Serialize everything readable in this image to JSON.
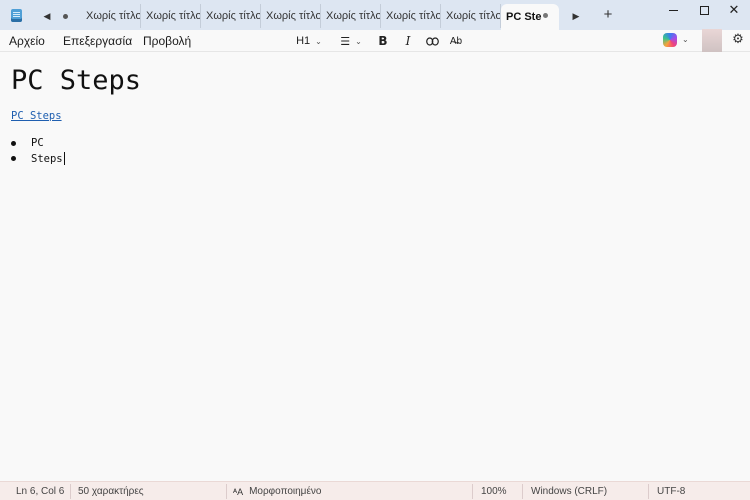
{
  "window": {
    "tabs": [
      {
        "label": "Χωρίς τίτλο"
      },
      {
        "label": "Χωρίς τίτλο"
      },
      {
        "label": "Χωρίς τίτλο"
      },
      {
        "label": "Χωρίς τίτλο"
      },
      {
        "label": "Χωρίς τίτλο"
      },
      {
        "label": "Χωρίς τίτλο"
      },
      {
        "label": "Χωρίς τίτλο"
      }
    ],
    "active_tab": {
      "label": "PC Ste"
    },
    "new_tab_glyph": "+",
    "close_glyph": "✕"
  },
  "menu": {
    "file": "Αρχείο",
    "edit": "Επεξεργασία",
    "view": "Προβολή"
  },
  "toolbar": {
    "heading": "H1",
    "list_glyph": "☰",
    "bold": "B",
    "italic": "I",
    "link_glyph": "🔗",
    "clear_format": "A̶b",
    "chevron": "⌄"
  },
  "icons": {
    "app": "notepad-icon",
    "back": "scroll-tabs-left-icon",
    "forward": "scroll-tabs-right-icon",
    "copilot": "copilot-icon",
    "settings": "gear-icon",
    "gear_glyph": "⚙"
  },
  "document": {
    "title": "PC Steps",
    "link": "PC Steps",
    "bullets": [
      "PC",
      "Steps"
    ]
  },
  "status": {
    "position": "Ln 6, Col 6",
    "chars": "50 χαρακτήρες",
    "format_icon": "ᴬA",
    "format": "Μορφοποιημένο",
    "zoom": "100%",
    "line_endings": "Windows (CRLF)",
    "encoding": "UTF-8"
  },
  "colors": {
    "titlebar": "#dde6f2",
    "link": "#1f5fb0",
    "statusbar": "#f6ecea"
  }
}
